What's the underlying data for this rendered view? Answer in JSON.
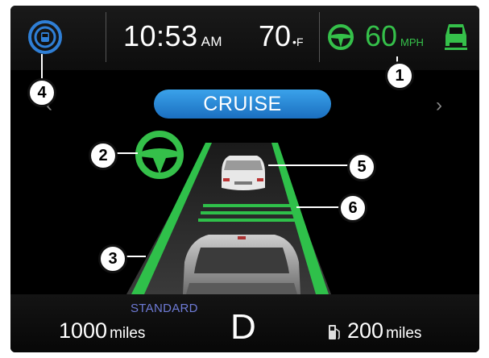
{
  "status_bar": {
    "time": "10:53",
    "time_suffix": "AM",
    "temperature": "70",
    "temperature_unit": "•F",
    "speed": "60",
    "speed_unit": "MPH"
  },
  "mode": {
    "label": "CRUISE",
    "prev_chevron": "‹",
    "next_chevron": "›"
  },
  "bottom_bar": {
    "trip_value": "1000",
    "trip_unit": "miles",
    "drive_mode": "STANDARD",
    "gear": "D",
    "range_value": "200",
    "range_unit": "miles"
  },
  "callouts": [
    "1",
    "2",
    "3",
    "4",
    "5",
    "6"
  ],
  "colors": {
    "active_green": "#35c04a",
    "pill_blue": "#2a8ddb",
    "icon_blue": "#2f7fd6"
  },
  "icons": [
    "traffic-sign-icon",
    "steering-wheel-icon",
    "vehicle-ahead-icon",
    "fuel-pump-icon"
  ]
}
